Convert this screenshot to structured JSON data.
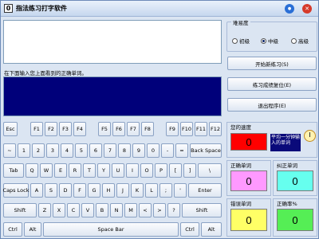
{
  "window": {
    "title": "指法练习打字软件",
    "icon_label": "0",
    "minimize": "●",
    "close": "✕"
  },
  "prompt_label": "在下面输入您上面看到的正确单词。",
  "keyboard": {
    "fn_row": [
      "Esc",
      "F1",
      "F2",
      "F3",
      "F4",
      "F5",
      "F6",
      "F7",
      "F8",
      "F9",
      "F10",
      "F11",
      "F12"
    ],
    "num_row": [
      "~",
      "1",
      "2",
      "3",
      "4",
      "5",
      "6",
      "7",
      "8",
      "9",
      "0",
      "-",
      "=",
      "Back Space"
    ],
    "q_row": [
      "Tab",
      "Q",
      "W",
      "E",
      "R",
      "T",
      "Y",
      "U",
      "I",
      "O",
      "P",
      "[",
      "]",
      "\\"
    ],
    "a_row": [
      "Caps Lock",
      "A",
      "S",
      "D",
      "F",
      "G",
      "H",
      "J",
      "K",
      "L",
      ";",
      "'",
      "Enter"
    ],
    "z_row": [
      "Shift",
      "Z",
      "X",
      "C",
      "V",
      "B",
      "N",
      "M",
      "<",
      ">",
      "?",
      "Shift"
    ],
    "bottom_row": [
      "Ctrl",
      "Alt",
      "Space Bar",
      "Ctrl",
      "Alt"
    ]
  },
  "difficulty": {
    "label": "难易度",
    "options": [
      "初级",
      "中级",
      "高级"
    ],
    "selected": 1
  },
  "buttons": {
    "start": "开始新练习(S)",
    "reset": "练习成绩复位(E)",
    "exit": "退出程序(E)"
  },
  "stats": {
    "speed": {
      "label": "您的速度",
      "value": "0",
      "color": "#ff0000"
    },
    "correct_words": {
      "label": "正确单词",
      "value": "0",
      "color": "#ff99ff"
    },
    "corrected_words": {
      "label": "纠正单词",
      "value": "0",
      "color": "#66ffee"
    },
    "error_words": {
      "label": "错误单词",
      "value": "0",
      "color": "#ffff66"
    },
    "accuracy": {
      "label": "正确率%",
      "value": "0",
      "color": "#55ee55"
    }
  },
  "speed_note": "平均一分钟输入的单词",
  "colors": {
    "input_bg": "#00007a",
    "minimize": "#2a6fd6",
    "close": "#d63a2a"
  }
}
